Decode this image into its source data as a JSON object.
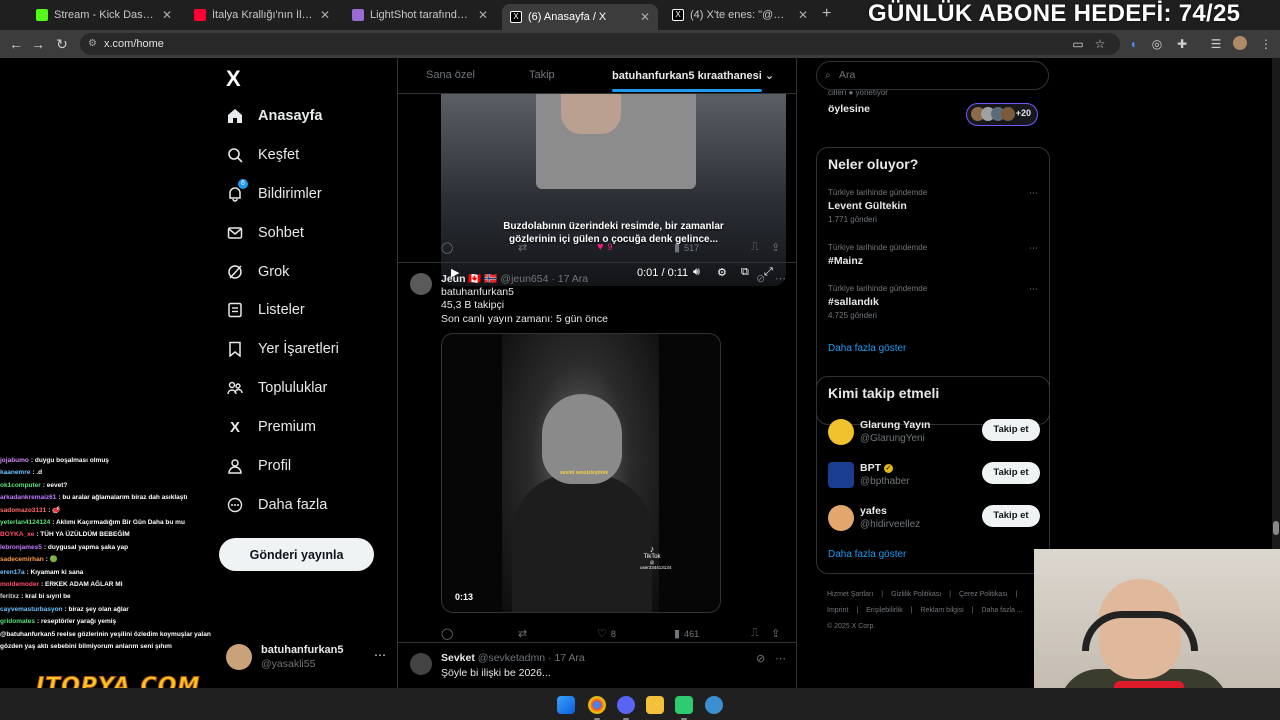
{
  "browser": {
    "tabs": [
      {
        "label": "Stream - Kick Dashboard",
        "color": "#53fc18",
        "active": false
      },
      {
        "label": "İtalya Krallığı'nın İlk Başkenti: To",
        "color": "#ff0033",
        "active": false
      },
      {
        "label": "LightShot tarafından Ekran Gör",
        "color": "#9a6bd4",
        "active": false
      },
      {
        "label": "(6) Anasayfa / X",
        "color": "#ffffff",
        "active": true
      },
      {
        "label": "(4) X'te enes: \"@mutantsertac h",
        "color": "#ffffff",
        "active": false
      }
    ],
    "new_tab_label": "+",
    "url": "x.com/home"
  },
  "overlay": {
    "goal_text": "GÜNLÜK ABONE HEDEFİ: 74/25",
    "brand_text": "ITOPYA.COM"
  },
  "nav": {
    "logo": "X",
    "items": [
      {
        "label": "Anasayfa",
        "icon": "home-icon",
        "glyph": "⌂",
        "bold": true
      },
      {
        "label": "Keşfet",
        "icon": "search-icon",
        "glyph": "⌕"
      },
      {
        "label": "Bildirimler",
        "icon": "bell-icon",
        "glyph": "🔔︎",
        "badge": "6"
      },
      {
        "label": "Sohbet",
        "icon": "mail-icon",
        "glyph": "✉"
      },
      {
        "label": "Grok",
        "icon": "grok-icon",
        "glyph": "⊘"
      },
      {
        "label": "Listeler",
        "icon": "list-icon",
        "glyph": "▤"
      },
      {
        "label": "Yer İşaretleri",
        "icon": "bookmark-icon",
        "glyph": "⎍"
      },
      {
        "label": "Topluluklar",
        "icon": "communities-icon",
        "glyph": "⚇"
      },
      {
        "label": "Premium",
        "icon": "x-premium-icon",
        "glyph": "X"
      },
      {
        "label": "Profil",
        "icon": "person-icon",
        "glyph": "♙"
      },
      {
        "label": "Daha fazla",
        "icon": "more-circle-icon",
        "glyph": "⋯"
      }
    ],
    "post_button": "Gönderi yayınla",
    "account": {
      "name": "batuhanfurkan5",
      "handle": "@yasakli55"
    }
  },
  "feed": {
    "tabs": [
      "Sana özel",
      "Takip",
      "batuhanfurkan5 kıraathanesi"
    ],
    "video1": {
      "caption_line1": "Buzdolabının üzerindeki resimde, bir zamanlar",
      "caption_line2": "gözlerinin içi gülen o çocuğa denk gelince...",
      "time": "0:01 / 0:11"
    },
    "post1_actions": {
      "replies": "",
      "reposts": "",
      "likes": "9",
      "views": "517"
    },
    "post2": {
      "name": "Jeun 🇨🇦 🇳🇴",
      "handle": "@jeun654 · 17 Ara",
      "text_lines": [
        "batuhanfurkan5",
        "45,3 B takipçi",
        "Son canlı yayın zamanı: 5 gün önce"
      ],
      "video_duration": "0:13",
      "video_caption": "sesini sessizleştirek",
      "tiktok_label": "TikTok",
      "tiktok_user": "@ user234413134",
      "actions": {
        "replies": "",
        "reposts": "",
        "likes": "8",
        "views": "461"
      }
    },
    "post3": {
      "name": "Sevket",
      "handle": "@sevketadmn · 17 Ara",
      "text": "Şöyle bi ilişki be 2026..."
    }
  },
  "right": {
    "search_placeholder": "Ara",
    "community": {
      "subtitle": "cilleri ● yönetiyor",
      "name": "öylesine",
      "member_count": "+20"
    },
    "trends_title": "Neler oluyor?",
    "trends": [
      {
        "context": "Türkiye tarihinde gündemde",
        "name": "Levent Gültekin",
        "count": "1.771 gönderi"
      },
      {
        "context": "Türkiye tarihinde gündemde",
        "name": "#Mainz",
        "count": ""
      },
      {
        "context": "Türkiye tarihinde gündemde",
        "name": "#sallandık",
        "count": "4.725 gönderi"
      }
    ],
    "show_more": "Daha fazla göster",
    "wtf_title": "Kimi takip etmeli",
    "wtf": [
      {
        "name": "Glarung Yayın",
        "handle": "@GlarungYeni",
        "button": "Takip et",
        "color": "#f2c12e",
        "verified": false
      },
      {
        "name": "BPT",
        "handle": "@bpthaber",
        "button": "Takip et",
        "color": "#1b3d8f",
        "verified": true
      },
      {
        "name": "yafes",
        "handle": "@hidirveellez",
        "button": "Takip et",
        "color": "#e3a76d",
        "verified": false
      }
    ],
    "wtf_show_more": "Daha fazla göster",
    "footer_line1": [
      "Hizmet Şartları",
      "Gizlilik Politikası",
      "Çerez Politikası"
    ],
    "footer_line2": [
      "Imprint",
      "Erişilebilirlik",
      "Reklam bilgisi",
      "Daha fazla ..."
    ],
    "footer_line3": "© 2025 X Corp."
  },
  "chat": [
    {
      "user": "jojabumo",
      "msg": ": duygu boşalması olmuş",
      "color": "#d48bf5"
    },
    {
      "user": "kaanemre",
      "msg": ": .d",
      "color": "#6cc3ff"
    },
    {
      "user": "ok1computer",
      "msg": ": eevet?",
      "color": "#59e07a"
    },
    {
      "user": "arkadankremaiz61",
      "msg": ": bu aralar ağlamalarım biraz dah asıklaştı",
      "color": "#c27cff"
    },
    {
      "user": "sadomazo3131",
      "msg": ": 🥩",
      "color": "#ff6b6b"
    },
    {
      "user": "yeterlan4124124",
      "msg": ": Aklımı Kaçırmadığım Bir Gün Daha bu mu",
      "color": "#59e07a"
    },
    {
      "user": "BOYKA_xe",
      "msg": ": TÜH YA ÜZÜLDÜM BEBEĞİM",
      "color": "#ff4d6d"
    },
    {
      "user": "lebronjames5",
      "msg": ": duygusal yapma şaka yap",
      "color": "#c27cff"
    },
    {
      "user": "sadecemirhan",
      "msg": ": 🟢",
      "color": "#ff9f43"
    },
    {
      "user": "eren17a",
      "msg": ": Kıyamam ki sana",
      "color": "#6cc3ff"
    },
    {
      "user": "moldemoder",
      "msg": ": ERKEK ADAM AĞLAR MI",
      "color": "#ff4d6d"
    },
    {
      "user": "feritxz",
      "msg": ": kral bi sıyrıl be",
      "color": "#d0d0d0"
    },
    {
      "user": "cayvemasturbasyon",
      "msg": ": biraz şey olan ağlar",
      "color": "#6cc3ff"
    },
    {
      "user": "gridomates",
      "msg": ": reseptörler yarağı yemiş",
      "color": "#59e07a"
    },
    {
      "user": "",
      "msg": "@batuhanfurkan5 reelse gözlerinin yeşilini özledim koymuşlar yalan",
      "color": "#ffffff"
    },
    {
      "user": "",
      "msg": "gözden yaş aktı sebebini bilmiyorum anlarım seni şıhım",
      "color": "#ffffff"
    }
  ]
}
